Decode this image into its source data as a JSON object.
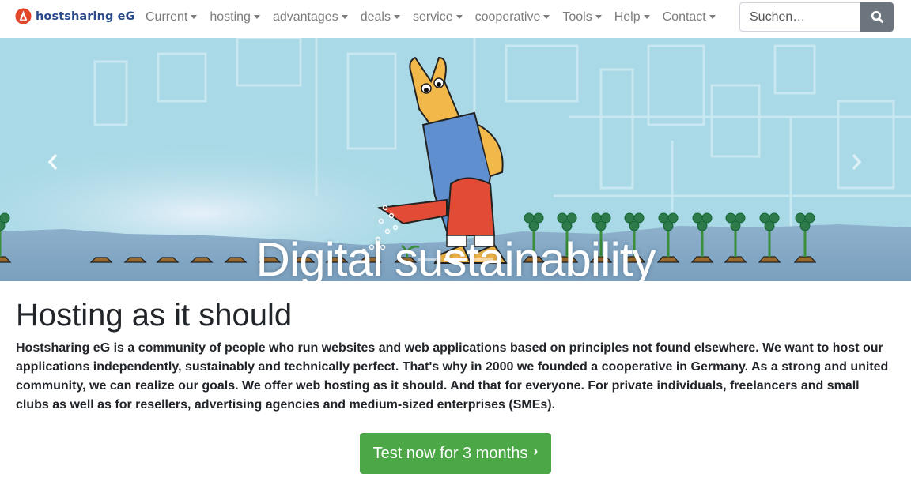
{
  "brand": {
    "name": "hostsharing eG",
    "logo_color": "#e4462b",
    "text_color": "#2a4a8c"
  },
  "nav": {
    "items": [
      {
        "label": "Current",
        "id": "current"
      },
      {
        "label": "hosting",
        "id": "hosting"
      },
      {
        "label": "advantages",
        "id": "advantages"
      },
      {
        "label": "deals",
        "id": "deals"
      },
      {
        "label": "service",
        "id": "service"
      },
      {
        "label": "cooperative",
        "id": "cooperative"
      },
      {
        "label": "Tools",
        "id": "tools"
      },
      {
        "label": "Help",
        "id": "help"
      },
      {
        "label": "Contact",
        "id": "contact"
      }
    ]
  },
  "search": {
    "placeholder": "Suchen…",
    "value": "",
    "button_icon": "search-icon"
  },
  "hero": {
    "caption": "Digital sustainability",
    "prev_icon": "chevron-left-icon",
    "next_icon": "chevron-right-icon",
    "slides": 3,
    "active_slide": 2
  },
  "main": {
    "title": "Hosting as it should",
    "lead": "Hostsharing eG is a community of people who run websites and web applications based on principles not found elsewhere. We want to host our applications independently, sustainably and technically perfect. That's why in 2000 we founded a cooperative in Germany. As a strong and united community, we can realize our goals. We offer web hosting as it should. And that for everyone. For private individuals, freelancers and small clubs as well as for resellers, advertising agencies and medium-sized enterprises (SMEs).",
    "cta_label": "Test now for 3 months",
    "cta_icon": "chevron-right-icon",
    "cta_color": "#4ca846"
  }
}
